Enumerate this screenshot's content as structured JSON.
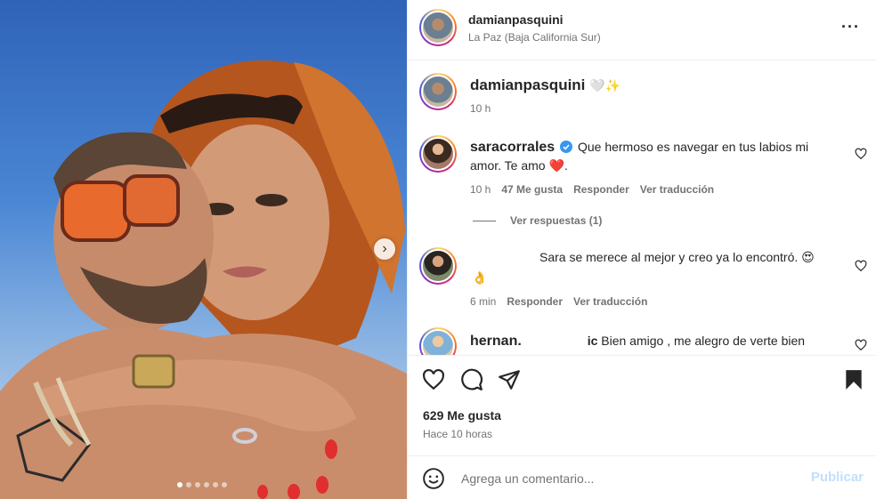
{
  "post": {
    "author": "damianpasquini",
    "location": "La Paz (Baja California Sur)",
    "more_icon": "more-horizontal-icon",
    "carousel": {
      "slides": 6,
      "active_index": 0
    }
  },
  "caption": {
    "author": "damianpasquini",
    "text": "🤍✨",
    "time": "10 h"
  },
  "comments": [
    {
      "author": "saracorrales",
      "verified": true,
      "text": "Que hermoso es navegar en tus labios mi amor. Te amo ❤️.",
      "time": "10 h",
      "likes": "47 Me gusta",
      "reply": "Responder",
      "translate": "Ver traducción",
      "view_replies": "Ver respuestas (1)"
    },
    {
      "author": "",
      "text": "Sara se merece al mejor y creo ya lo encontró. 😍",
      "emoji_line": "👌",
      "time": "6 min",
      "reply": "Responder",
      "translate": "Ver traducción"
    },
    {
      "author": "hernan.",
      "author_suffix": "ic",
      "text": "Bien amigo , me alegro de verte bien"
    }
  ],
  "actions": {
    "likes": "629 Me gusta",
    "posted": "Hace 10 horas",
    "icons": [
      "heart-icon",
      "comment-icon",
      "share-icon",
      "bookmark-icon"
    ]
  },
  "composer": {
    "placeholder": "Agrega un comentario...",
    "publish": "Publicar",
    "publish_color": "#c0dffd"
  },
  "colors": {
    "link_disabled": "#c0dffd",
    "heart_red": "#ed2b3a",
    "verified_blue": "#3897f0"
  }
}
